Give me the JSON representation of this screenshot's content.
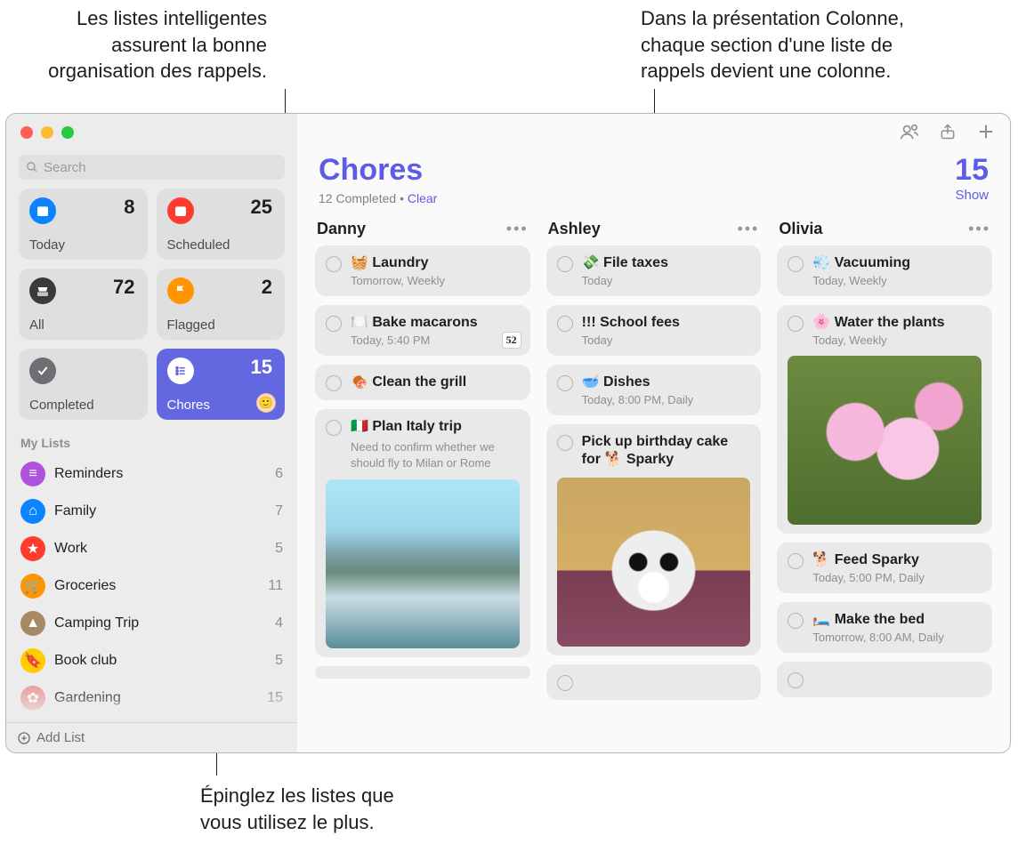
{
  "callouts": {
    "smart_lists": "Les listes intelligentes\nassurent la bonne\norganisation des rappels.",
    "column_view": "Dans la présentation Colonne,\nchaque section d'une liste de\nrappels devient une colonne.",
    "pin_lists": "Épinglez les listes que\nvous utilisez le plus."
  },
  "search": {
    "placeholder": "Search"
  },
  "smart_lists": {
    "today": {
      "label": "Today",
      "count": "8",
      "color": "#0a84ff"
    },
    "scheduled": {
      "label": "Scheduled",
      "count": "25",
      "color": "#ff3b30"
    },
    "all": {
      "label": "All",
      "count": "72",
      "color": "#3a3a3c"
    },
    "flagged": {
      "label": "Flagged",
      "count": "2",
      "color": "#ff9500"
    },
    "completed": {
      "label": "Completed",
      "count": "",
      "color": "#6e6e73"
    },
    "chores": {
      "label": "Chores",
      "count": "15",
      "color": "#6367e0"
    }
  },
  "my_lists_label": "My Lists",
  "my_lists": [
    {
      "name": "Reminders",
      "count": "6",
      "color": "#af52de",
      "glyph": "≡"
    },
    {
      "name": "Family",
      "count": "7",
      "color": "#0a84ff",
      "glyph": "⌂"
    },
    {
      "name": "Work",
      "count": "5",
      "color": "#ff3b30",
      "glyph": "★"
    },
    {
      "name": "Groceries",
      "count": "11",
      "color": "#ff9500",
      "glyph": "🛒"
    },
    {
      "name": "Camping Trip",
      "count": "4",
      "color": "#a68a64",
      "glyph": "▲"
    },
    {
      "name": "Book club",
      "count": "5",
      "color": "#ffcc00",
      "glyph": "🔖"
    },
    {
      "name": "Gardening",
      "count": "15",
      "color": "#e8a0a0",
      "glyph": "✿"
    }
  ],
  "add_list_label": "Add List",
  "header": {
    "title": "Chores",
    "completed": "12 Completed",
    "separator": "  •  ",
    "clear": "Clear",
    "count": "15",
    "show": "Show"
  },
  "columns": [
    {
      "name": "Danny",
      "items": [
        {
          "title": "🧺 Laundry",
          "sub": "Tomorrow, Weekly"
        },
        {
          "title": "🍽️ Bake macarons",
          "sub": "Today, 5:40 PM",
          "badge": "52"
        },
        {
          "title": "🍖 Clean the grill"
        },
        {
          "title": "🇮🇹 Plan Italy trip",
          "note": "Need to confirm whether we should fly to Milan or Rome",
          "image": "harbor"
        }
      ]
    },
    {
      "name": "Ashley",
      "items": [
        {
          "title": "💸 File taxes",
          "sub": "Today"
        },
        {
          "title": "!!! School fees",
          "sub": "Today"
        },
        {
          "title": "🥣 Dishes",
          "sub": "Today, 8:00 PM, Daily"
        },
        {
          "title": "Pick up birthday cake for 🐕 Sparky",
          "image": "dog"
        }
      ]
    },
    {
      "name": "Olivia",
      "items": [
        {
          "title": "💨 Vacuuming",
          "sub": "Today, Weekly"
        },
        {
          "title": "🌸 Water the plants",
          "sub": "Today, Weekly",
          "image": "flowers"
        },
        {
          "title": "🐕 Feed Sparky",
          "sub": "Today, 5:00 PM, Daily"
        },
        {
          "title": "🛏️ Make the bed",
          "sub": "Tomorrow, 8:00 AM, Daily"
        }
      ]
    }
  ]
}
